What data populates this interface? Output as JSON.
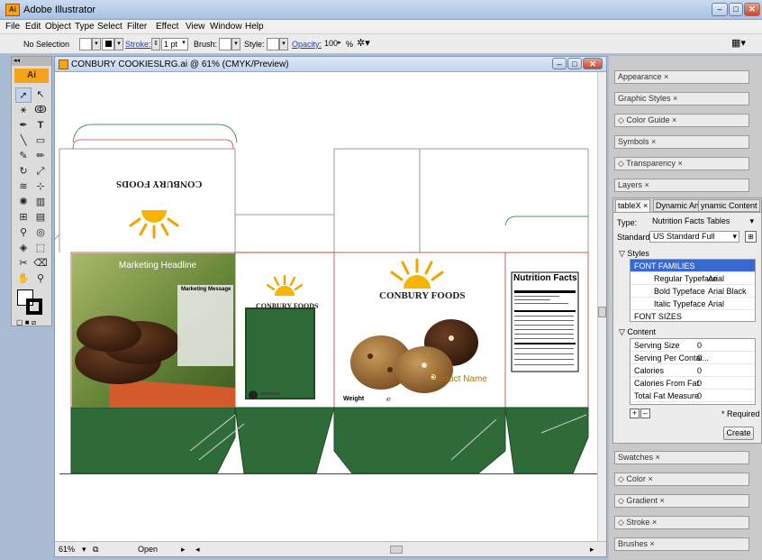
{
  "window": {
    "title": "Adobe Illustrator",
    "app_badge": "Ai"
  },
  "menu": [
    "File",
    "Edit",
    "Object",
    "Type",
    "Select",
    "Filter",
    "Effect",
    "View",
    "Window",
    "Help"
  ],
  "control_bar": {
    "selection": "No Selection",
    "stroke_label": "Stroke:",
    "stroke_value": "1 pt",
    "brush_label": "Brush:",
    "style_label": "Style:",
    "opacity_label": "Opacity:",
    "opacity_value": "100",
    "opacity_unit": "%"
  },
  "document": {
    "title": "CONBURY COOKIESLRG.ai @ 61% (CMYK/Preview)",
    "zoom": "61%",
    "status": "Open"
  },
  "artwork": {
    "brand_upside": "CONBURY FOODS",
    "brand_small": "CONBURY FOODS",
    "brand_main": "CONBURY FOODS",
    "marketing_headline": "Marketing Headline",
    "marketing_message": "Marketing Message",
    "nutrition_title": "Nutrition Facts",
    "product_name": "Product Name",
    "weight_label": "Weight",
    "weight_icon": "℮"
  },
  "panels": {
    "appearance": "Appearance",
    "graphic_styles": "Graphic Styles",
    "color_guide": "Color Guide",
    "symbols": "Symbols",
    "transparency": "Transparency",
    "layers": "Layers",
    "swatches": "Swatches",
    "color": "Color",
    "gradient": "Gradient",
    "stroke": "Stroke",
    "brushes": "Brushes"
  },
  "tablex": {
    "tabs": [
      "tableX",
      "Dynamic Art",
      "ynamic Content"
    ],
    "type_label": "Type:",
    "type_value": "Nutrition Facts Tables",
    "standard_label": "Standard:",
    "standard_value": "US Standard Full",
    "styles_header": "Styles",
    "styles_rows": [
      {
        "label": "FONT FAMILIES",
        "value": "",
        "highlight": true,
        "indent": false
      },
      {
        "label": "Regular Typeface",
        "value": "Arial",
        "highlight": false,
        "indent": true
      },
      {
        "label": "Bold Typeface",
        "value": "Arial Black",
        "highlight": false,
        "indent": true
      },
      {
        "label": "Italic Typeface",
        "value": "Arial",
        "highlight": false,
        "indent": true
      },
      {
        "label": "FONT SIZES",
        "value": "",
        "highlight": false,
        "indent": false
      }
    ],
    "content_header": "Content",
    "content_rows": [
      {
        "label": "Serving Size",
        "value": "0"
      },
      {
        "label": "Serving Per Contai...",
        "value": "0"
      },
      {
        "label": "Calories",
        "value": "0"
      },
      {
        "label": "Calories From Fat",
        "value": "0"
      },
      {
        "label": "Total Fat Measure",
        "value": "0"
      }
    ],
    "required_note": "* Required",
    "create_label": "Create"
  }
}
